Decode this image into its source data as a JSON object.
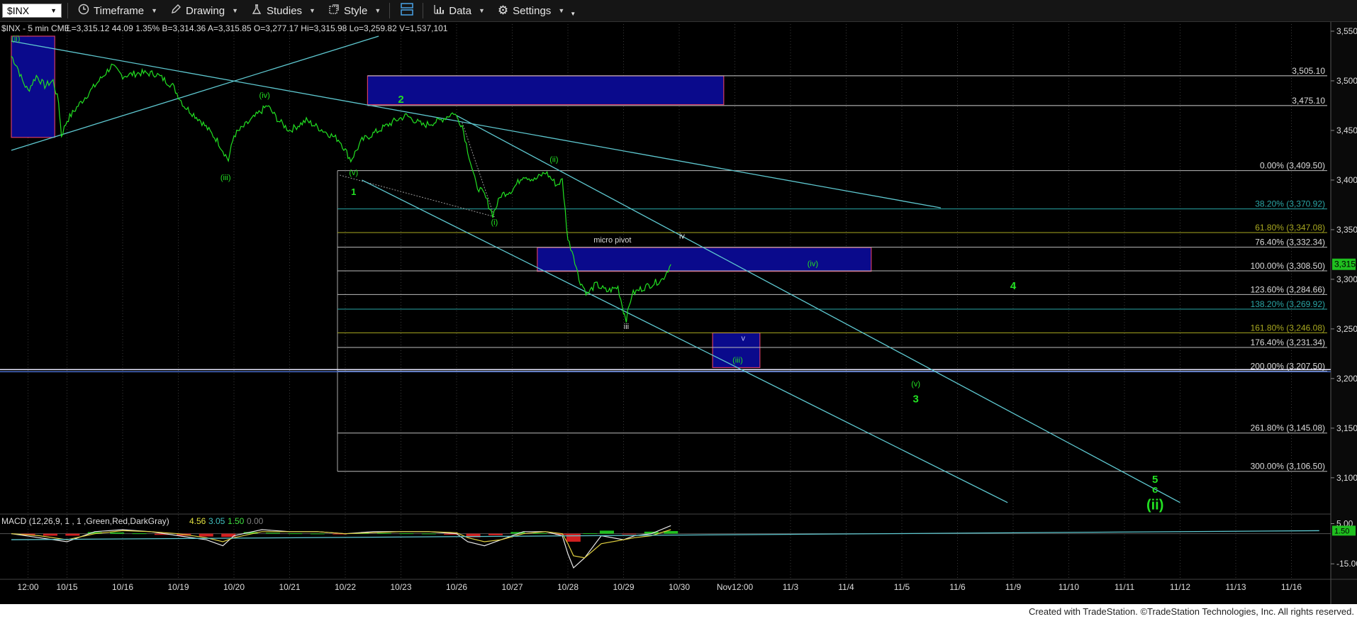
{
  "toolbar": {
    "symbol": "$INX",
    "timeframe": "Timeframe",
    "drawing": "Drawing",
    "studies": "Studies",
    "style": "Style",
    "data": "Data",
    "settings": "Settings"
  },
  "header": {
    "symbol_line": "$INX - 5 min  CME",
    "quote": "L=3,315.12  44.09  1.35%  B=3,314.36  A=3,315.85  O=3,277.17  Hi=3,315.98  Lo=3,259.82  V=1,537,101",
    "last_price": "3,315.12"
  },
  "chart_data": {
    "type": "line",
    "symbol": "$INX",
    "interval": "5 min",
    "price_axis": {
      "ticks": [
        "3,550.00",
        "3,500.00",
        "3,450.00",
        "3,400.00",
        "3,350.00",
        "3,300.00",
        "3,250.00",
        "3,200.00",
        "3,150.00",
        "3,100.00"
      ],
      "tick_values": [
        3550,
        3500,
        3450,
        3400,
        3350,
        3300,
        3250,
        3200,
        3150,
        3100
      ],
      "range": [
        3067,
        3560
      ]
    },
    "time_axis": {
      "labels": [
        "12:00",
        "10/15",
        "10/16",
        "10/19",
        "10/20",
        "10/21",
        "10/22",
        "10/23",
        "10/26",
        "10/27",
        "10/28",
        "10/29",
        "10/30",
        "Nov12:00",
        "11/3",
        "11/4",
        "11/5",
        "11/6",
        "11/9",
        "11/10",
        "11/11",
        "11/12",
        "11/13",
        "11/16"
      ],
      "label_slots": [
        0.3,
        1,
        2,
        3,
        4,
        5,
        6,
        7,
        8,
        9,
        10,
        11,
        12,
        13,
        14,
        15,
        16,
        17,
        18,
        19,
        20,
        21,
        22,
        23
      ]
    },
    "series": [
      {
        "type": "price",
        "color": "#22e022",
        "points": [
          [
            0.0,
            3525
          ],
          [
            0.1,
            3515
          ],
          [
            0.2,
            3500
          ],
          [
            0.3,
            3490
          ],
          [
            0.45,
            3505
          ],
          [
            0.6,
            3495
          ],
          [
            0.75,
            3500
          ],
          [
            0.85,
            3478
          ],
          [
            0.9,
            3445
          ],
          [
            1.0,
            3460
          ],
          [
            1.2,
            3475
          ],
          [
            1.5,
            3495
          ],
          [
            1.8,
            3515
          ],
          [
            2.0,
            3505
          ],
          [
            2.3,
            3508
          ],
          [
            2.6,
            3507
          ],
          [
            2.9,
            3495
          ],
          [
            3.1,
            3475
          ],
          [
            3.4,
            3460
          ],
          [
            3.7,
            3440
          ],
          [
            3.9,
            3420
          ],
          [
            4.0,
            3445
          ],
          [
            4.3,
            3460
          ],
          [
            4.6,
            3475
          ],
          [
            4.8,
            3460
          ],
          [
            5.0,
            3450
          ],
          [
            5.3,
            3460
          ],
          [
            5.6,
            3450
          ],
          [
            5.9,
            3440
          ],
          [
            6.1,
            3420
          ],
          [
            6.3,
            3440
          ],
          [
            6.6,
            3450
          ],
          [
            6.9,
            3460
          ],
          [
            7.1,
            3465
          ],
          [
            7.4,
            3455
          ],
          [
            7.7,
            3460
          ],
          [
            7.95,
            3468
          ],
          [
            8.1,
            3455
          ],
          [
            8.2,
            3430
          ],
          [
            8.35,
            3395
          ],
          [
            8.5,
            3385
          ],
          [
            8.65,
            3365
          ],
          [
            8.8,
            3385
          ],
          [
            9.0,
            3390
          ],
          [
            9.2,
            3405
          ],
          [
            9.4,
            3400
          ],
          [
            9.6,
            3408
          ],
          [
            9.8,
            3395
          ],
          [
            9.9,
            3400
          ],
          [
            10.0,
            3340
          ],
          [
            10.1,
            3325
          ],
          [
            10.2,
            3300
          ],
          [
            10.35,
            3285
          ],
          [
            10.5,
            3295
          ],
          [
            10.7,
            3288
          ],
          [
            10.9,
            3292
          ],
          [
            11.0,
            3268
          ],
          [
            11.05,
            3260
          ],
          [
            11.15,
            3285
          ],
          [
            11.3,
            3290
          ],
          [
            11.5,
            3295
          ],
          [
            11.7,
            3300
          ],
          [
            11.85,
            3315
          ]
        ]
      }
    ],
    "fibonacci": [
      {
        "label": "0.00% (3,409.50)",
        "value": 3409.5,
        "color": "#bbbbbb"
      },
      {
        "label": "38.20% (3,370.92)",
        "value": 3370.92,
        "color": "#2aa6a6"
      },
      {
        "label": "61.80% (3,347.08)",
        "value": 3347.08,
        "color": "#a8a820"
      },
      {
        "label": "76.40% (3,332.34)",
        "value": 3332.34,
        "color": "#bbbbbb"
      },
      {
        "label": "100.00% (3,308.50)",
        "value": 3308.5,
        "color": "#bbbbbb"
      },
      {
        "label": "123.60% (3,284.66)",
        "value": 3284.66,
        "color": "#bbbbbb"
      },
      {
        "label": "138.20% (3,269.92)",
        "value": 3269.92,
        "color": "#2aa6a6"
      },
      {
        "label": "161.80% (3,246.08)",
        "value": 3246.08,
        "color": "#a8a820"
      },
      {
        "label": "176.40% (3,231.34)",
        "value": 3231.34,
        "color": "#bbbbbb"
      },
      {
        "label": "200.00% (3,207.50)",
        "value": 3207.5,
        "color": "#bbbbbb"
      },
      {
        "label": "261.80% (3,145.08)",
        "value": 3145.08,
        "color": "#bbbbbb"
      },
      {
        "label": "300.00% (3,106.50)",
        "value": 3106.5,
        "color": "#bbbbbb"
      }
    ],
    "resistance_lines": [
      {
        "label": "3,505.10",
        "value": 3505.1
      },
      {
        "label": "3,475.10",
        "value": 3475.1
      }
    ],
    "support_line_value": 3209,
    "zones": [
      {
        "from_slot": 0.0,
        "to_slot": 0.78,
        "low": 3443,
        "high": 3545
      },
      {
        "from_slot": 6.4,
        "to_slot": 12.8,
        "low": 3476,
        "high": 3505
      },
      {
        "from_slot": 9.45,
        "to_slot": 15.45,
        "low": 3308,
        "high": 3332
      },
      {
        "from_slot": 12.6,
        "to_slot": 13.45,
        "low": 3211,
        "high": 3246
      }
    ],
    "wave_labels": [
      {
        "text": "(ii)",
        "slot": 0.08,
        "value": 3540,
        "color": "#22e022",
        "size": 11
      },
      {
        "text": "(iii)",
        "slot": 3.85,
        "value": 3400,
        "color": "#22e022",
        "size": 11
      },
      {
        "text": "(iv)",
        "slot": 4.55,
        "value": 3483,
        "color": "#22e022",
        "size": 11
      },
      {
        "text": "(v)",
        "slot": 6.15,
        "value": 3405,
        "color": "#22e022",
        "size": 11
      },
      {
        "text": "1",
        "slot": 6.15,
        "value": 3385,
        "color": "#22e022",
        "size": 13
      },
      {
        "text": "2",
        "slot": 7.0,
        "value": 3478,
        "color": "#22e022",
        "size": 15
      },
      {
        "text": "(i)",
        "slot": 8.68,
        "value": 3355,
        "color": "#22e022",
        "size": 11
      },
      {
        "text": "(ii)",
        "slot": 9.75,
        "value": 3418,
        "color": "#22e022",
        "size": 11
      },
      {
        "text": "micro pivot",
        "slot": 10.8,
        "value": 3337,
        "color": "#dddddd",
        "size": 11
      },
      {
        "text": "iv",
        "slot": 12.05,
        "value": 3341,
        "color": "#dddddd",
        "size": 11
      },
      {
        "text": "(iv)",
        "slot": 14.4,
        "value": 3313,
        "color": "#22e022",
        "size": 11
      },
      {
        "text": "iii",
        "slot": 11.05,
        "value": 3250,
        "color": "#dddddd",
        "size": 11
      },
      {
        "text": "v",
        "slot": 13.15,
        "value": 3238,
        "color": "#bbbbff",
        "size": 11
      },
      {
        "text": "(iii)",
        "slot": 13.05,
        "value": 3216,
        "color": "#22e022",
        "size": 11
      },
      {
        "text": "4",
        "slot": 18.0,
        "value": 3290,
        "color": "#22e022",
        "size": 15
      },
      {
        "text": "(v)",
        "slot": 16.25,
        "value": 3192,
        "color": "#22e022",
        "size": 11
      },
      {
        "text": "3",
        "slot": 16.25,
        "value": 3176,
        "color": "#22e022",
        "size": 15
      },
      {
        "text": "5",
        "slot": 20.55,
        "value": 3095,
        "color": "#22e022",
        "size": 15
      },
      {
        "text": "c",
        "slot": 20.55,
        "value": 3085,
        "color": "#22e022",
        "size": 15
      },
      {
        "text": "(ii)",
        "slot": 20.55,
        "value": 3068,
        "color": "#22e022",
        "size": 20
      }
    ],
    "trendlines": [
      {
        "x1": 0.0,
        "y1": 3540,
        "x2": 16.7,
        "y2": 3372
      },
      {
        "x1": 8.0,
        "y1": 3465,
        "x2": 21.0,
        "y2": 3075
      },
      {
        "x1": 6.3,
        "y1": 3400,
        "x2": 17.9,
        "y2": 3075
      },
      {
        "x1": 0.0,
        "y1": 3430,
        "x2": 6.6,
        "y2": 3545
      }
    ],
    "macd": {
      "label": "MACD (12,26,9, 1 , 1 ,Green,Red,DarkGray)",
      "values": [
        "4.56",
        "3.05",
        "1.50",
        "0.00"
      ],
      "value_colors": [
        "#e0e040",
        "#40c0c0",
        "#40e040",
        "#808080"
      ],
      "axis_ticks": [
        "5.00",
        "-15.00"
      ],
      "axis_values": [
        5,
        -15
      ],
      "current": "1.50",
      "range": [
        -22,
        8
      ],
      "macd_line": [
        [
          0,
          0
        ],
        [
          0.5,
          -2
        ],
        [
          1,
          -4
        ],
        [
          1.5,
          1
        ],
        [
          2,
          2
        ],
        [
          2.5,
          1
        ],
        [
          3,
          -1
        ],
        [
          3.5,
          -3
        ],
        [
          3.8,
          -6
        ],
        [
          4,
          -1
        ],
        [
          4.5,
          2
        ],
        [
          5,
          1
        ],
        [
          5.5,
          1
        ],
        [
          6,
          0
        ],
        [
          6.5,
          1
        ],
        [
          7,
          1
        ],
        [
          7.5,
          1
        ],
        [
          8,
          0
        ],
        [
          8.2,
          -4
        ],
        [
          8.5,
          -6
        ],
        [
          8.8,
          -3
        ],
        [
          9.2,
          1
        ],
        [
          9.6,
          1
        ],
        [
          9.9,
          -1
        ],
        [
          10,
          -10
        ],
        [
          10.1,
          -17
        ],
        [
          10.3,
          -12
        ],
        [
          10.6,
          -1
        ],
        [
          11,
          -3
        ],
        [
          11.2,
          -1
        ],
        [
          11.5,
          0
        ],
        [
          11.85,
          4
        ]
      ],
      "signal_line": [
        [
          0,
          0
        ],
        [
          0.5,
          -1
        ],
        [
          1,
          -3
        ],
        [
          1.5,
          0
        ],
        [
          2,
          1.5
        ],
        [
          2.5,
          1
        ],
        [
          3,
          0
        ],
        [
          3.5,
          -2
        ],
        [
          3.8,
          -4
        ],
        [
          4,
          -2
        ],
        [
          4.5,
          1
        ],
        [
          5,
          1
        ],
        [
          5.5,
          1
        ],
        [
          6,
          0
        ],
        [
          6.5,
          0.5
        ],
        [
          7,
          1
        ],
        [
          7.5,
          1
        ],
        [
          8,
          0.5
        ],
        [
          8.2,
          -2
        ],
        [
          8.5,
          -4
        ],
        [
          8.8,
          -3
        ],
        [
          9.2,
          0
        ],
        [
          9.6,
          1
        ],
        [
          9.9,
          0
        ],
        [
          10,
          -5
        ],
        [
          10.1,
          -11
        ],
        [
          10.3,
          -12
        ],
        [
          10.6,
          -5
        ],
        [
          11,
          -3
        ],
        [
          11.2,
          -2
        ],
        [
          11.5,
          -1
        ],
        [
          11.85,
          2
        ]
      ],
      "histogram": [
        [
          0.3,
          -0.8
        ],
        [
          0.7,
          -1
        ],
        [
          1.1,
          -1
        ],
        [
          1.5,
          0.8
        ],
        [
          1.9,
          0.6
        ],
        [
          2.3,
          0.2
        ],
        [
          2.7,
          -0.6
        ],
        [
          3.1,
          -1
        ],
        [
          3.5,
          -1.4
        ],
        [
          3.9,
          -1.6
        ],
        [
          4.3,
          0.8
        ],
        [
          4.7,
          0.4
        ],
        [
          5.1,
          0.2
        ],
        [
          5.5,
          0.1
        ],
        [
          5.9,
          -0.2
        ],
        [
          6.3,
          0.3
        ],
        [
          6.7,
          0.3
        ],
        [
          7.1,
          0.2
        ],
        [
          7.5,
          0.1
        ],
        [
          7.9,
          -0.5
        ],
        [
          8.3,
          -1.8
        ],
        [
          8.7,
          -0.8
        ],
        [
          9.1,
          0.8
        ],
        [
          9.5,
          0.3
        ],
        [
          9.9,
          -0.6
        ],
        [
          10.1,
          -4
        ],
        [
          10.4,
          0.2
        ],
        [
          10.7,
          1.5
        ],
        [
          11.1,
          -0.3
        ],
        [
          11.5,
          1
        ],
        [
          11.85,
          1.3
        ]
      ],
      "trendline": [
        [
          0,
          -3
        ],
        [
          23.5,
          1.5
        ]
      ]
    }
  },
  "footer": {
    "credit": "Created with TradeStation. ©TradeStation Technologies, Inc. All rights reserved."
  }
}
